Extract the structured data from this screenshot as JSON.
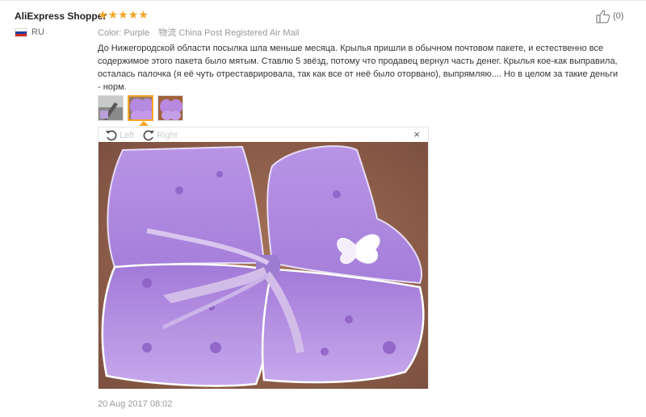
{
  "reviewer": {
    "name": "AliExpress Shopper",
    "country_code": "RU",
    "rating": 5
  },
  "order": {
    "color_label": "Color:",
    "color_value": "Purple",
    "shipping_label": "物流",
    "shipping_value": "China Post Registered Air Mail"
  },
  "helpful": {
    "count": "(0)"
  },
  "review": {
    "text": "До Нижегородской области посылка шла меньше месяца. Крылья пришли в обычном почтовом пакете, и естественно все содержимое этого пакета было мятым. Ставлю 5 звёзд, потому что продавец вернул часть денег. Крылья кое-как выправила, осталась палочка (я её чуть отреставрировала, так как все от неё было оторвано), выпрямляю.... Но в целом за такие деньги - норм.",
    "date": "20 Aug 2017 08:02"
  },
  "viewer": {
    "rotate_left_label": "Left",
    "rotate_right_label": "Right",
    "close_symbol": "×",
    "thumbnail_count": 3,
    "active_thumbnail": 2
  },
  "colors": {
    "star": "#f5a623",
    "active_border": "#f5a623",
    "wing_purple": "#b08be0"
  }
}
